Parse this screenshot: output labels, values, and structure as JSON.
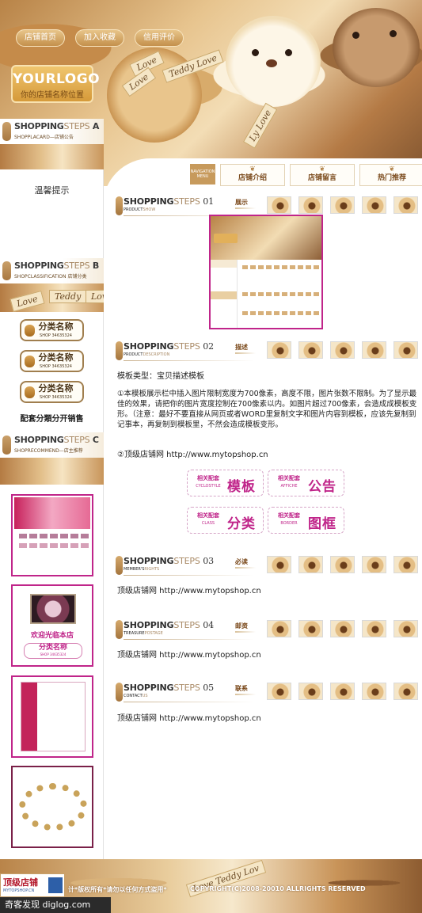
{
  "header": {
    "nav": [
      "店铺首页",
      "加入收藏",
      "信用评价"
    ],
    "logo_main": "YOURLOGO",
    "logo_sub": "你的店铺名称位置",
    "ribbon_text": [
      "Love",
      "Teddy Love",
      "Love",
      "Ly Love"
    ],
    "tabs_nav_label": "NAVIGATION MENU",
    "tabs": [
      "店铺介绍",
      "店铺留言",
      "热门推荐"
    ]
  },
  "sidebar": {
    "sections": [
      {
        "title_dark": "SHOPPING",
        "title_light": "STEPS",
        "letter": "A",
        "sub_en": "SHOPPLACARD",
        "sub_cn": "店铺公告"
      },
      {
        "title_dark": "SHOPPING",
        "title_light": "STEPS",
        "letter": "B",
        "sub_en": "SHOPCLASSIFICATION",
        "sub_cn": "店铺分类"
      },
      {
        "title_dark": "SHOPPING",
        "title_light": "STEPS",
        "letter": "C",
        "sub_en": "SHOPRECOMMEND",
        "sub_cn": "店主推荐"
      }
    ],
    "notice": "温馨提示",
    "banner_text": [
      "Love",
      "Teddy",
      "Lov"
    ],
    "categories": [
      {
        "name": "分类名称",
        "code": "SHOP 34635324"
      },
      {
        "name": "分类名称",
        "code": "SHOP 34635324"
      },
      {
        "name": "分类名称",
        "code": "SHOP 34635324"
      }
    ],
    "category_caption": "配套分類分开销售",
    "promo2_welcome": "欢迎光临本店",
    "promo2_cat_name": "分类名称",
    "promo2_cat_code": "SHOP 34635324"
  },
  "main": {
    "sections": [
      {
        "num": "01",
        "sub_dark": "PRODUCT",
        "sub_light": "SHOW",
        "label": "展示"
      },
      {
        "num": "02",
        "sub_dark": "PRODUCT",
        "sub_light": "DESCRIPTION",
        "label": "描述"
      },
      {
        "num": "03",
        "sub_dark": "MEMBER'S",
        "sub_light": "RIGHTS",
        "label": "必读"
      },
      {
        "num": "04",
        "sub_dark": "TREASURE",
        "sub_light": "POSTAGE",
        "label": "邮资"
      },
      {
        "num": "05",
        "sub_dark": "CONTACT",
        "sub_light": "US",
        "label": "联系"
      }
    ],
    "title_dark": "SHOPPING",
    "title_light": "STEPS",
    "template_type": "模板类型：宝贝描述模板",
    "paragraph": "①本模板展示栏中插入图片限制宽度为700像素，高度不限，图片张数不限制。为了显示最佳的效果，请把你的图片宽度控制在700像素以内。如图片超过700像素，会造成成模板变形。（注意：最好不要直接从网页或者WORD里复制文字和图片内容到模板，应该先复制到记事本，再复制到模板里，不然会造成模板变形。",
    "link_line": "②顶级店铺网  http://www.mytopshop.cn",
    "site_line": "顶级店铺网  http://www.mytopshop.cn",
    "pill_links": [
      {
        "small": "相关配套",
        "en": "CYCLOSTYLE",
        "big": "模板"
      },
      {
        "small": "相关配套",
        "en": "AFFICHE",
        "big": "公告"
      },
      {
        "small": "相关配套",
        "en": "CLASS",
        "big": "分类"
      },
      {
        "small": "相关配套",
        "en": "BORDER",
        "big": "图框"
      }
    ]
  },
  "footer": {
    "logo_main": "顶级店铺",
    "logo_sub": "MYTOPSHOP.CN",
    "copy_cn": "计*版权所有*请勿以任何方式盗用*",
    "copy_en": "COPYRIGHT(C)2008-20010 ALLRIGHTS RESERVED",
    "ribbon": "Love  Teddy Lov"
  },
  "watermark": "奇客发现 diglog.com",
  "colors": {
    "accent": "#c0258a",
    "brown": "#7b4a1c",
    "gold": "#c4904c"
  }
}
